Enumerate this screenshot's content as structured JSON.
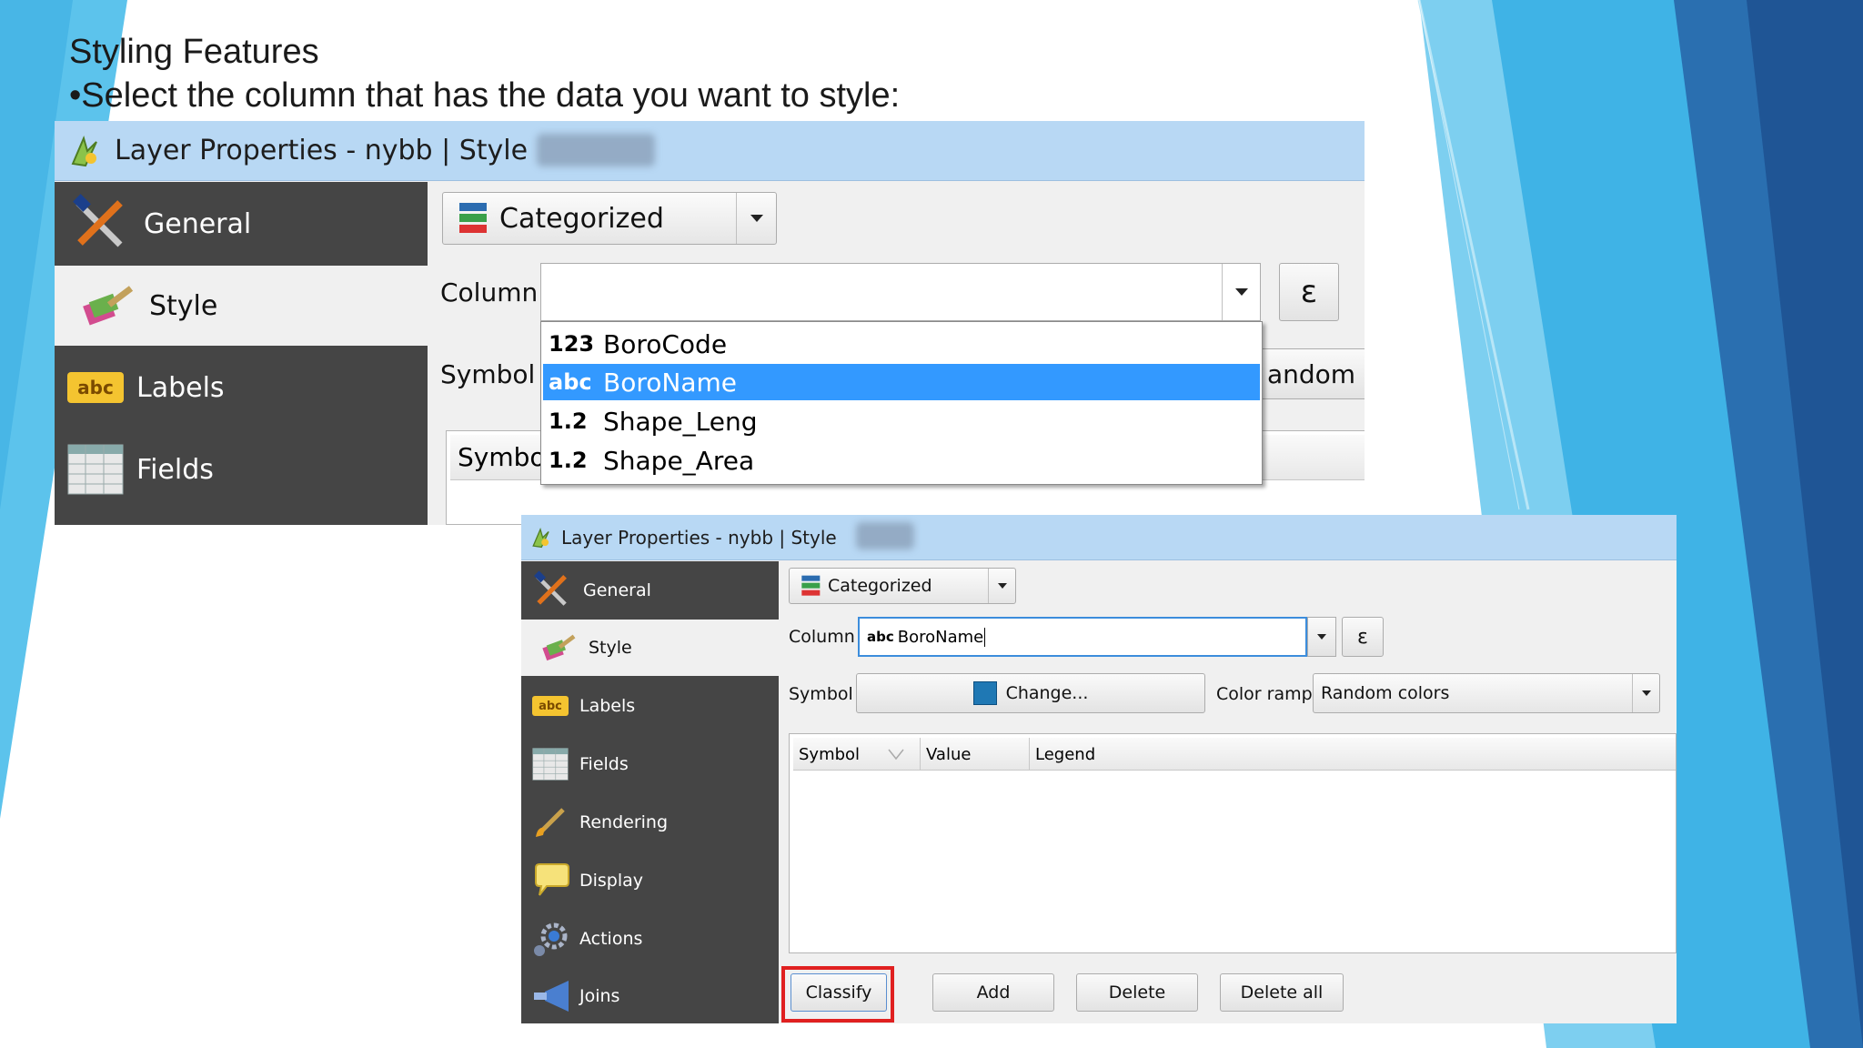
{
  "slide": {
    "title": "Styling Features",
    "bullet": "•Select the column that has the data you want to style:"
  },
  "win1": {
    "title": "Layer Properties - nybb | Style",
    "sidebar": [
      {
        "label": "General"
      },
      {
        "label": "Style"
      },
      {
        "label": "Labels"
      },
      {
        "label": "Fields"
      }
    ],
    "renderer": "Categorized",
    "column_label": "Column",
    "symbol_label": "Symbol",
    "expr_button": "ε",
    "dropdown": [
      {
        "type": "123",
        "name": "BoroCode"
      },
      {
        "type": "abc",
        "name": "BoroName"
      },
      {
        "type": "1.2",
        "name": "Shape_Leng"
      },
      {
        "type": "1.2",
        "name": "Shape_Area"
      }
    ],
    "partial_text": "andom c",
    "table_header_symbol": "Symbol"
  },
  "win2": {
    "title": "Layer Properties - nybb | Style",
    "sidebar": [
      {
        "label": "General"
      },
      {
        "label": "Style"
      },
      {
        "label": "Labels"
      },
      {
        "label": "Fields"
      },
      {
        "label": "Rendering"
      },
      {
        "label": "Display"
      },
      {
        "label": "Actions"
      },
      {
        "label": "Joins"
      }
    ],
    "renderer": "Categorized",
    "column_label": "Column",
    "column_type": "abc",
    "column_value": "BoroName",
    "expr_button": "ε",
    "symbol_label": "Symbol",
    "change_button": "Change...",
    "color_ramp_label": "Color ramp",
    "color_ramp_value": "Random colors",
    "table_headers": [
      "Symbol",
      "Value",
      "Legend"
    ],
    "buttons": {
      "classify": "Classify",
      "add": "Add",
      "delete": "Delete",
      "delete_all": "Delete all"
    }
  },
  "colors": {
    "selection": "#3399ff",
    "title_bar": "#b8d8f4",
    "sidebar": "#454545",
    "highlight_frame": "#e02020",
    "swatch": "#1f78b4"
  }
}
